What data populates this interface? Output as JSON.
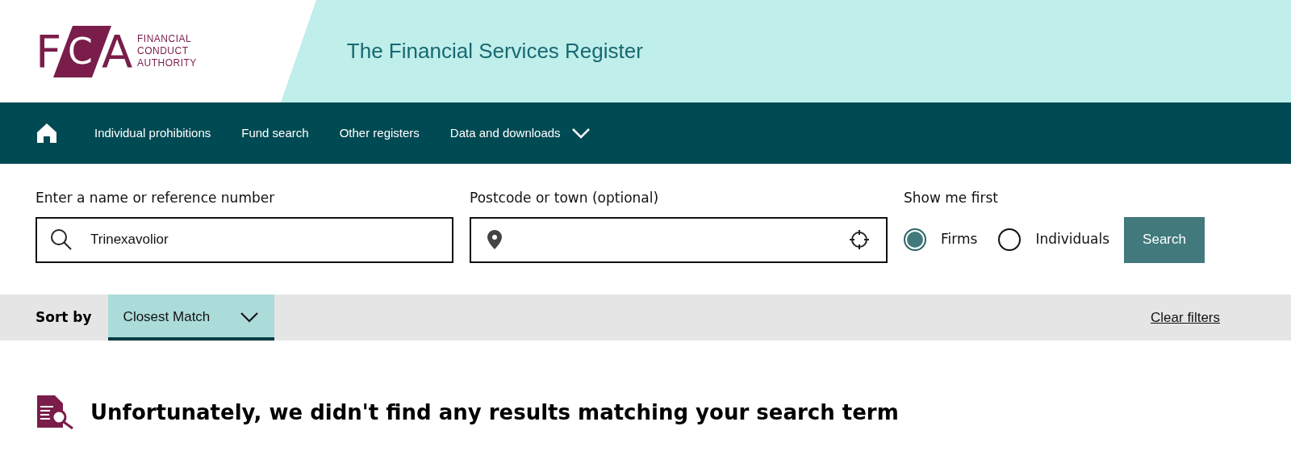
{
  "logo": {
    "letters": [
      "F",
      "C",
      "A"
    ],
    "words": [
      "FINANCIAL",
      "CONDUCT",
      "AUTHORITY"
    ]
  },
  "header": {
    "title": "The Financial Services Register"
  },
  "nav": {
    "items": [
      {
        "label": "Individual prohibitions",
        "kind": "link"
      },
      {
        "label": "Fund search",
        "kind": "link"
      },
      {
        "label": "Other registers",
        "kind": "link"
      },
      {
        "label": "Data and downloads",
        "kind": "dropdown"
      }
    ]
  },
  "search": {
    "name_label": "Enter a name or reference number",
    "name_value": "Trinexavolior",
    "location_label": "Postcode or town (optional)",
    "show_label": "Show me first",
    "options": [
      {
        "label": "Firms",
        "selected": true
      },
      {
        "label": "Individuals",
        "selected": false
      }
    ],
    "button": "Search"
  },
  "sort": {
    "label": "Sort by",
    "value": "Closest Match",
    "clear": "Clear filters"
  },
  "message": "Unfortunately, we didn't find any results matching your search term"
}
